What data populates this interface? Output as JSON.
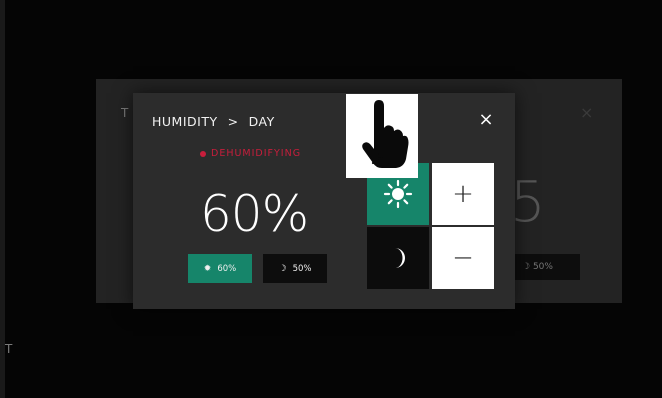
{
  "background": {
    "left_letter_top": "T",
    "left_letter_bottom": "T",
    "ghost_value": "5",
    "ghost_mode": "",
    "ghost_chip": "50%",
    "ghost_close": "×"
  },
  "modal": {
    "breadcrumb": {
      "parent": "HUMIDITY",
      "separator": ">",
      "current": "DAY"
    },
    "close_label": "×",
    "mode_text": "DEHUMIDIFYING",
    "value": "60%",
    "chips": {
      "day": {
        "value": "60%",
        "icon": "sun-icon"
      },
      "night": {
        "value": "50%",
        "icon": "moon-icon"
      }
    },
    "controls": {
      "day_icon": "sun-icon",
      "night_icon": "moon-icon",
      "increase": "+",
      "decrease": "−"
    }
  },
  "colors": {
    "accent_green": "#16856a",
    "mode_red": "#c81e3c",
    "panel": "#2c2c2c"
  },
  "overlay": {
    "icon": "tap-hand-icon"
  }
}
